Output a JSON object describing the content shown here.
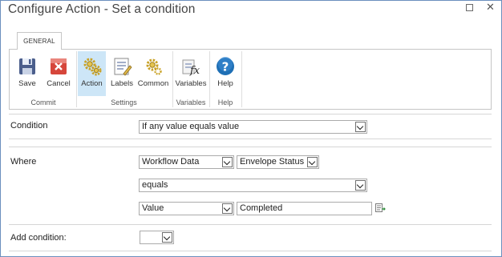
{
  "dialog": {
    "title": "Configure Action - Set a condition"
  },
  "ribbon": {
    "tab": "GENERAL",
    "groups": {
      "commit": {
        "label": "Commit",
        "buttons": {
          "save": "Save",
          "cancel": "Cancel"
        }
      },
      "settings": {
        "label": "Settings",
        "buttons": {
          "action": "Action",
          "labels": "Labels",
          "common": "Common"
        }
      },
      "variables": {
        "label": "Variables",
        "buttons": {
          "variables": "Variables"
        }
      },
      "help": {
        "label": "Help",
        "buttons": {
          "help": "Help"
        }
      }
    },
    "selected_button": "Action"
  },
  "form": {
    "condition": {
      "label": "Condition",
      "value": "If any value equals value"
    },
    "where": {
      "label": "Where",
      "source": "Workflow Data",
      "field": "Envelope Status",
      "operator": "equals",
      "value_type": "Value",
      "value": "Completed"
    },
    "add_condition": {
      "label": "Add condition:",
      "value": ""
    }
  },
  "colors": {
    "accent": "#1e6fb5",
    "selected_bg": "#cde6f7",
    "border": "#ababab"
  }
}
